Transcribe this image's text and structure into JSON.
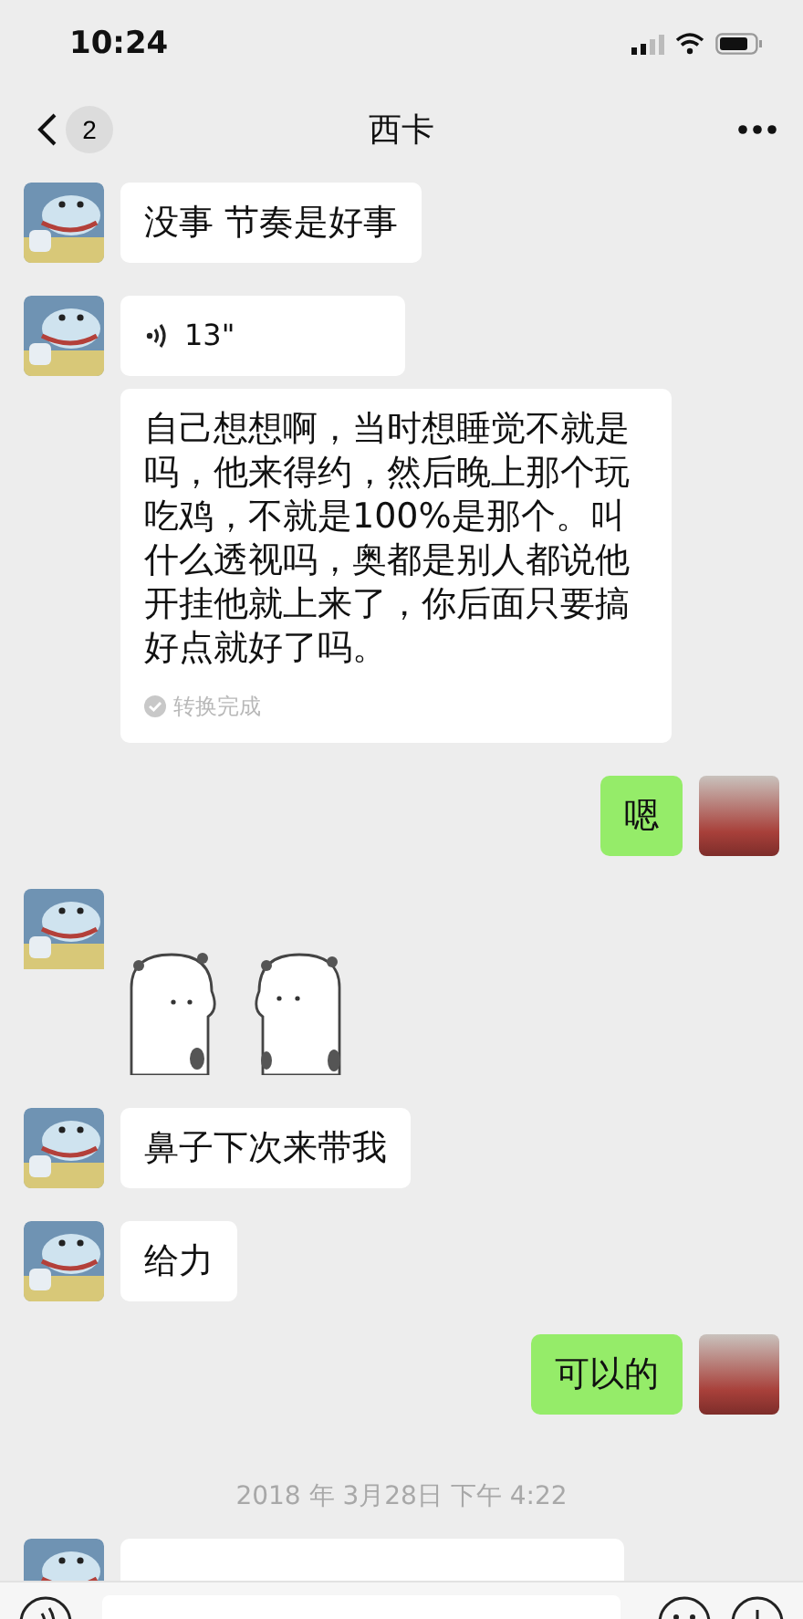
{
  "status_bar": {
    "time": "10:24"
  },
  "nav": {
    "unread": "2",
    "title": "西卡"
  },
  "messages": [
    {
      "outgoing": false,
      "kind": "text",
      "text": "没事 节奏是好事"
    },
    {
      "outgoing": false,
      "kind": "voice",
      "duration": "13\"",
      "transcription": "自己想想啊，当时想睡觉不就是吗，他来得约，然后晚上那个玩吃鸡，不就是100%是那个。叫什么透视吗，奥都是别人都说他开挂他就上来了，你后面只要搞好点就好了吗。",
      "transcription_status": "转换完成"
    },
    {
      "outgoing": true,
      "kind": "text",
      "text": "嗯"
    },
    {
      "outgoing": false,
      "kind": "sticker"
    },
    {
      "outgoing": false,
      "kind": "text",
      "text": "鼻子下次来带我"
    },
    {
      "outgoing": false,
      "kind": "text",
      "text": "给力"
    },
    {
      "outgoing": true,
      "kind": "text",
      "text": "可以的"
    },
    {
      "kind": "time",
      "text": "2018 年 3月28日 下午 4:22"
    },
    {
      "outgoing": false,
      "kind": "cut"
    }
  ]
}
